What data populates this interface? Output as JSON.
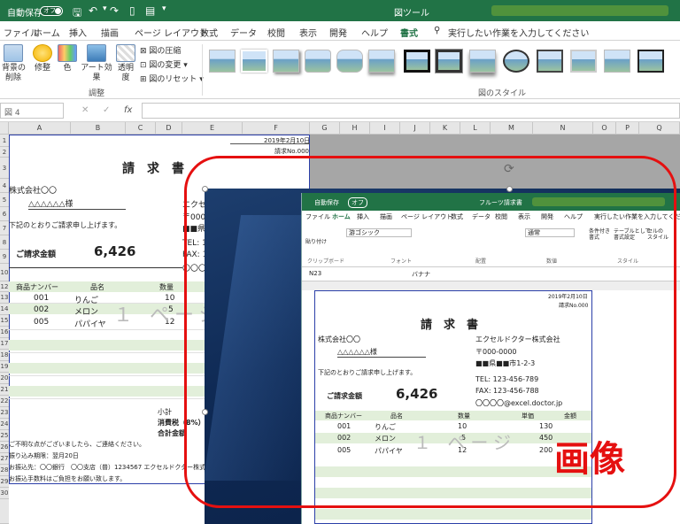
{
  "titlebar": {
    "autosave": "自動保存",
    "autosave_state": "オフ",
    "context_tab": "図ツール"
  },
  "tabs": [
    "ファイル",
    "ホーム",
    "挿入",
    "描画",
    "ページ レイアウト",
    "数式",
    "データ",
    "校閲",
    "表示",
    "開発",
    "ヘルプ",
    "書式"
  ],
  "active_tab": "書式",
  "search_placeholder": "実行したい作業を入力してください",
  "ribbon": {
    "remove_bg": "背景の\n削除",
    "corrections": "修整",
    "color": "色",
    "artistic": "アート効果",
    "transparency": "透明\n度",
    "compress": "図の圧縮",
    "change": "図の変更",
    "reset": "図のリセット",
    "group_adjust": "調整",
    "group_styles": "図のスタイル"
  },
  "namebox": "図 4",
  "fx": "fx",
  "columns": [
    "A",
    "B",
    "C",
    "D",
    "E",
    "F",
    "G",
    "H",
    "I",
    "J",
    "K",
    "L",
    "M",
    "N",
    "O",
    "P",
    "Q"
  ],
  "invoice": {
    "date": "2019年2月10日",
    "number": "請求No.000",
    "title": "請　求　書",
    "client_company": "株式会社〇〇",
    "client_name": "△△△△△△様",
    "note": "下記のとおりご請求申し上げます。",
    "amount_label": "ご請求金額",
    "amount": "6,426",
    "hdr_code": "商品ナンバー",
    "hdr_name": "品名",
    "hdr_qty": "数量",
    "items": [
      {
        "code": "001",
        "name": "りんご",
        "qty": "10"
      },
      {
        "code": "002",
        "name": "メロン",
        "qty": "5"
      },
      {
        "code": "005",
        "name": "パパイヤ",
        "qty": "12"
      }
    ],
    "subtotal": "小計",
    "tax": "消費税（8%）",
    "total": "合計金額",
    "footer1": "ご不明な点がございましたら、ご連絡ください。",
    "footer2": "振り込み期限：翌月20日",
    "footer3": "お振込先：〇〇銀行　〇〇支店（普）1234567 エクセルドクター株式",
    "footer4": "お振込手数料はご負担をお願い致します。",
    "watermark": "１ ページ",
    "seller_partial": "エクセル",
    "tel_partial": "TEL: 1",
    "fax_partial": "FAX: 1",
    "zip_partial": "〒000-",
    "addr_partial": "■■県",
    "mail_partial": "〇〇〇"
  },
  "inner": {
    "title": "フルーツ請求書",
    "tabs": [
      "ファイル",
      "ホーム",
      "挿入",
      "描画",
      "ページ レイアウト",
      "数式",
      "データ",
      "校閲",
      "表示",
      "開発",
      "ヘルプ"
    ],
    "search": "実行したい作業を入力してください",
    "namebox": "N23",
    "formula": "バナナ",
    "font": "游ゴシック",
    "number_format": "通常",
    "groups": [
      "クリップボード",
      "フォント",
      "配置",
      "数値",
      "スタイル"
    ],
    "paste": "貼り付け",
    "cond_format": "条件付き\n書式",
    "table_format": "テーブルとして\n書式設定",
    "cell_style": "セルの\nスタイル",
    "hdr_price": "単価",
    "hdr_amount": "金額",
    "seller": "エクセルドクター株式会社",
    "zip": "〒000-0000",
    "addr": "■■県■■市1-2-3",
    "tel": "TEL: 123-456-789",
    "fax": "FAX: 123-456-788",
    "mail": "〇〇〇〇@excel.doctor.jp",
    "prices": [
      "130",
      "450",
      "200"
    ]
  },
  "overlay_label": "画像"
}
